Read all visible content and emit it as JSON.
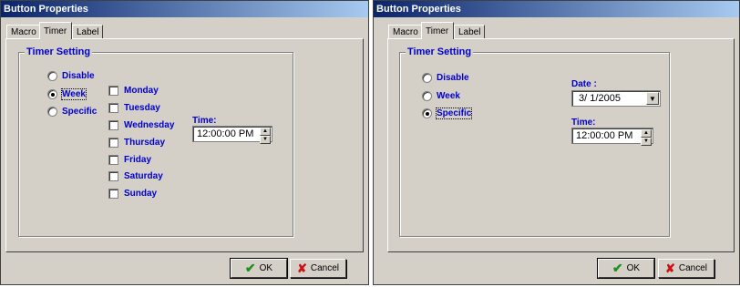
{
  "dialog_left": {
    "title": "Button Properties",
    "tabs": [
      "Macro",
      "Timer",
      "Label"
    ],
    "active_tab": "Timer",
    "group_label": "Timer Setting",
    "radios": [
      {
        "label": "Disable",
        "checked": false
      },
      {
        "label": "Week",
        "checked": true
      },
      {
        "label": "Specific",
        "checked": false
      }
    ],
    "days": [
      {
        "label": "Monday",
        "checked": false
      },
      {
        "label": "Tuesday",
        "checked": false
      },
      {
        "label": "Wednesday",
        "checked": false
      },
      {
        "label": "Thursday",
        "checked": false
      },
      {
        "label": "Friday",
        "checked": false
      },
      {
        "label": "Saturday",
        "checked": false
      },
      {
        "label": "Sunday",
        "checked": false
      }
    ],
    "time_label": "Time:",
    "time_value": "12:00:00 PM",
    "ok_label": "OK",
    "cancel_label": "Cancel"
  },
  "dialog_right": {
    "title": "Button Properties",
    "tabs": [
      "Macro",
      "Timer",
      "Label"
    ],
    "active_tab": "Timer",
    "group_label": "Timer Setting",
    "radios": [
      {
        "label": "Disable",
        "checked": false
      },
      {
        "label": "Week",
        "checked": false
      },
      {
        "label": "Specific",
        "checked": true
      }
    ],
    "date_label": "Date :",
    "date_value": " 3/ 1/2005",
    "time_label": "Time:",
    "time_value": "12:00:00 PM",
    "ok_label": "OK",
    "cancel_label": "Cancel"
  },
  "icons": {
    "ok": "checkmark-icon",
    "cancel": "x-icon",
    "dropdown": "chevron-down-icon"
  },
  "colors": {
    "titlebar_start": "#0a246a",
    "titlebar_end": "#a6caf0",
    "label_blue": "#0000cc",
    "face": "#d4d0c8"
  }
}
